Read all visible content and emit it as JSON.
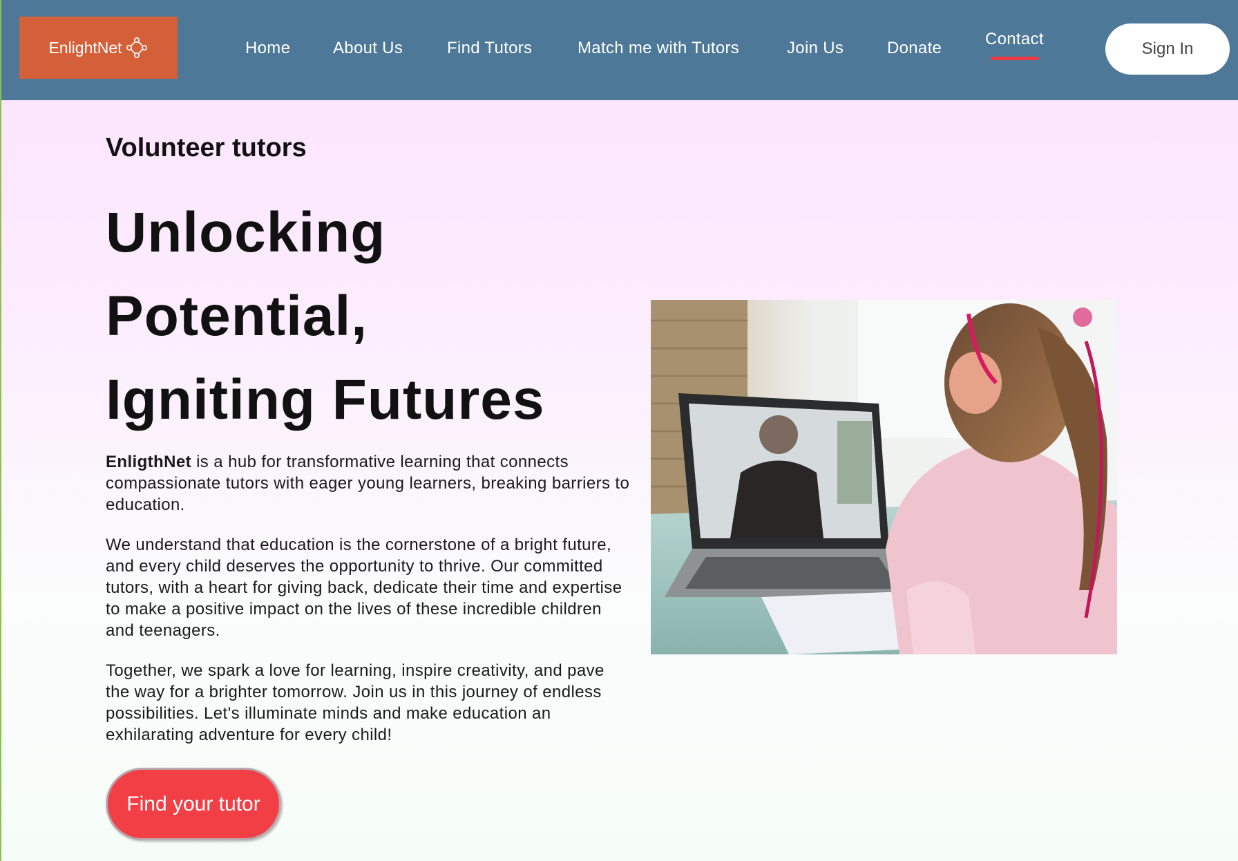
{
  "brand": {
    "name": "EnlightNet",
    "icon": "network-nodes-icon",
    "color": "#d4603a"
  },
  "nav": {
    "items": [
      {
        "label": "Home"
      },
      {
        "label": "About Us"
      },
      {
        "label": "Find Tutors"
      },
      {
        "label": "Match me with Tutors"
      },
      {
        "label": "Join Us"
      },
      {
        "label": "Donate"
      },
      {
        "label": "Contact",
        "active": true
      }
    ],
    "sign_in": "Sign In",
    "bar_color": "#4d7898",
    "active_underline_color": "#ef3a44"
  },
  "hero": {
    "eyebrow": "Volunteer tutors",
    "headline": [
      "Unlocking",
      "Potential,",
      "Igniting Futures"
    ],
    "p1_brand": "EnligthNet",
    "p1_rest": " is a hub for transformative learning that connects compassionate tutors with eager young learners, breaking barriers to education.",
    "p2": "We understand that education is the cornerstone of a bright future, and every child deserves the opportunity to thrive. Our committed tutors, with a heart for giving back, dedicate their time and expertise to make a positive impact on the lives of these incredible children and teenagers.",
    "p3": "Together, we spark a love for learning, inspire creativity, and pave the way for a brighter tomorrow. Join us in this journey of endless possibilities. Let's illuminate minds and make education an exhilarating adventure for every child!",
    "cta": "Find your tutor",
    "cta_color": "#f23f46"
  }
}
